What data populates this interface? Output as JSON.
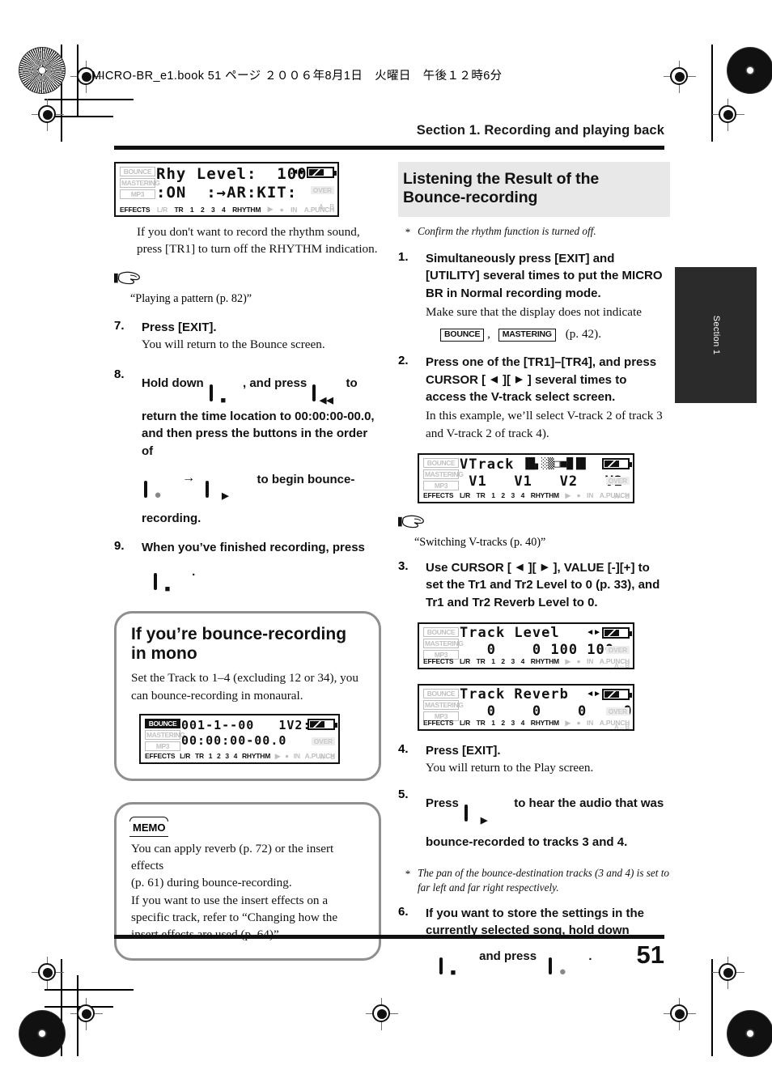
{
  "document": {
    "book_header": "MICRO-BR_e1.book 51 ページ ２００６年8月1日　火曜日　午後１２時6分",
    "section_header": "Section 1. Recording and playing back",
    "side_tab": "Section 1",
    "page_number": "51"
  },
  "left_column": {
    "lcd_rhythm": {
      "mode_labels": [
        "BOUNCE",
        "MASTERING",
        "MP3"
      ],
      "row1": "Rhy Level:  100",
      "row2": ":ON  :→AR:KIT:",
      "bottom_labels": [
        "EFFECTS",
        "L/R",
        "TR",
        "1",
        "2",
        "3",
        "4",
        "RHYTHM",
        "IN",
        "A.PUNCH"
      ],
      "right_labels": [
        "OVER",
        "A↔B"
      ]
    },
    "intro_text": "If you don't want to record the rhythm sound, press [TR1] to turn off the RHYTHM indication.",
    "ref_1": "“Playing a pattern (p. 82)”",
    "steps": [
      {
        "num": "7.",
        "bold": "Press [EXIT].",
        "plain": "You will return to the Bounce screen."
      },
      {
        "num": "8.",
        "part_a": "Hold down",
        "part_b": ", and press",
        "part_c": "to",
        "part_d": "return the time location to 00:00:00-00.0, and then press the buttons in the order of",
        "part_e": "to begin bounce-recording."
      },
      {
        "num": "9.",
        "bold": "When you’ve finished recording, press",
        "trailer": "."
      }
    ],
    "mono_box": {
      "title": "If you’re bounce-recording in mono",
      "body": "Set the Track to 1–4 (excluding 12 or 34), you can bounce-recording in monaural.",
      "lcd": {
        "mode_labels": [
          "BOUNCE",
          "MASTERING",
          "MP3"
        ],
        "row1": "001-1--00   1V2:",
        "row2": "00:00:00-00.0",
        "bottom_labels": [
          "EFFECTS",
          "L/R",
          "TR",
          "1",
          "2",
          "3",
          "4",
          "RHYTHM",
          "IN",
          "A.PUNCH"
        ],
        "right_labels": [
          "OVER",
          "A↔B"
        ]
      }
    },
    "memo_box": {
      "badge": "MEMO",
      "body": "You can apply reverb (p. 72) or the insert effects\n(p. 61) during bounce-recording.\nIf you want to use the insert effects on a specific track, refer to “Changing how the insert effects are used (p. 64)”."
    }
  },
  "right_column": {
    "title": "Listening the Result of the Bounce-recording",
    "note_1": "Confirm the rhythm function is turned off.",
    "step1": {
      "num": "1.",
      "bold": "Simultaneously press [EXIT] and [UTILITY] several times to put the MICRO BR in Normal recording mode.",
      "plain": "Make sure that the display does not indicate",
      "tag_bounce": "BOUNCE",
      "tag_mastering": "MASTERING",
      "plain_tail": "(p. 42)."
    },
    "step2": {
      "num": "2.",
      "bold_a": "Press one of the [TR1]–[TR4], and press CURSOR [",
      "bold_b": "][",
      "bold_c": "] several times to access the V-track select screen.",
      "plain": "In this example, we’ll select V-track 2 of track 3 and V-track 2 of track 4)."
    },
    "lcd_vtrack": {
      "mode_labels": [
        "BOUNCE",
        "MASTERING",
        "MP3"
      ],
      "row1": "VTrack",
      "row1_meter": "▐█▖░▒□■█▐█",
      "row2": " V1   V1   V2   V2",
      "bottom_labels": [
        "EFFECTS",
        "L/R",
        "TR",
        "1",
        "2",
        "3",
        "4",
        "RHYTHM",
        "IN",
        "A.PUNCH"
      ],
      "right_labels": [
        "OVER",
        "A↔B"
      ]
    },
    "ref_2": "“Switching V-tracks (p. 40)”",
    "step3": {
      "num": "3.",
      "bold_a": "Use CURSOR [",
      "bold_b": "][",
      "bold_c": "], VALUE [-][+] to set the Tr1 and Tr2 Level to 0 (p. 33), and Tr1 and Tr2 Reverb Level to 0."
    },
    "lcd_track_level": {
      "mode_labels": [
        "BOUNCE",
        "MASTERING",
        "MP3"
      ],
      "row1": "Track Level",
      "row2": "   0    0 100 100",
      "bottom_labels": [
        "EFFECTS",
        "L/R",
        "TR",
        "1",
        "2",
        "3",
        "4",
        "RHYTHM",
        "IN",
        "A.PUNCH"
      ],
      "right_labels": [
        "OVER",
        "A↔B"
      ]
    },
    "lcd_track_reverb": {
      "mode_labels": [
        "BOUNCE",
        "MASTERING",
        "MP3"
      ],
      "row1": "Track Reverb",
      "row2": "   0    0    0    0",
      "bottom_labels": [
        "EFFECTS",
        "L/R",
        "TR",
        "1",
        "2",
        "3",
        "4",
        "RHYTHM",
        "IN",
        "A.PUNCH"
      ],
      "right_labels": [
        "OVER",
        "A↔B"
      ]
    },
    "step4": {
      "num": "4.",
      "bold": "Press [EXIT].",
      "plain": "You will return to the Play screen."
    },
    "step5": {
      "num": "5.",
      "bold_a": "Press",
      "bold_b": "to hear the audio that was bounce-recorded to tracks 3 and 4."
    },
    "note_2": "The pan of the bounce-destination tracks (3 and 4) is set to far left and far right respectively.",
    "step6": {
      "num": "6.",
      "bold_a": "If you want to store the settings in the currently selected song, hold down",
      "bold_b": "and press",
      "bold_c": "."
    }
  },
  "icons": {
    "stop": "■",
    "rewind": "◀◀",
    "record": "●",
    "play": "▶",
    "cursor_left": "◀",
    "cursor_right": "▶",
    "arrow_right": "→"
  },
  "colors": {
    "title_box_bg": "#e8e8e8",
    "callout_border": "#8f8f8f",
    "side_tab_bg": "#2b2b2b",
    "rule": "#111111"
  }
}
